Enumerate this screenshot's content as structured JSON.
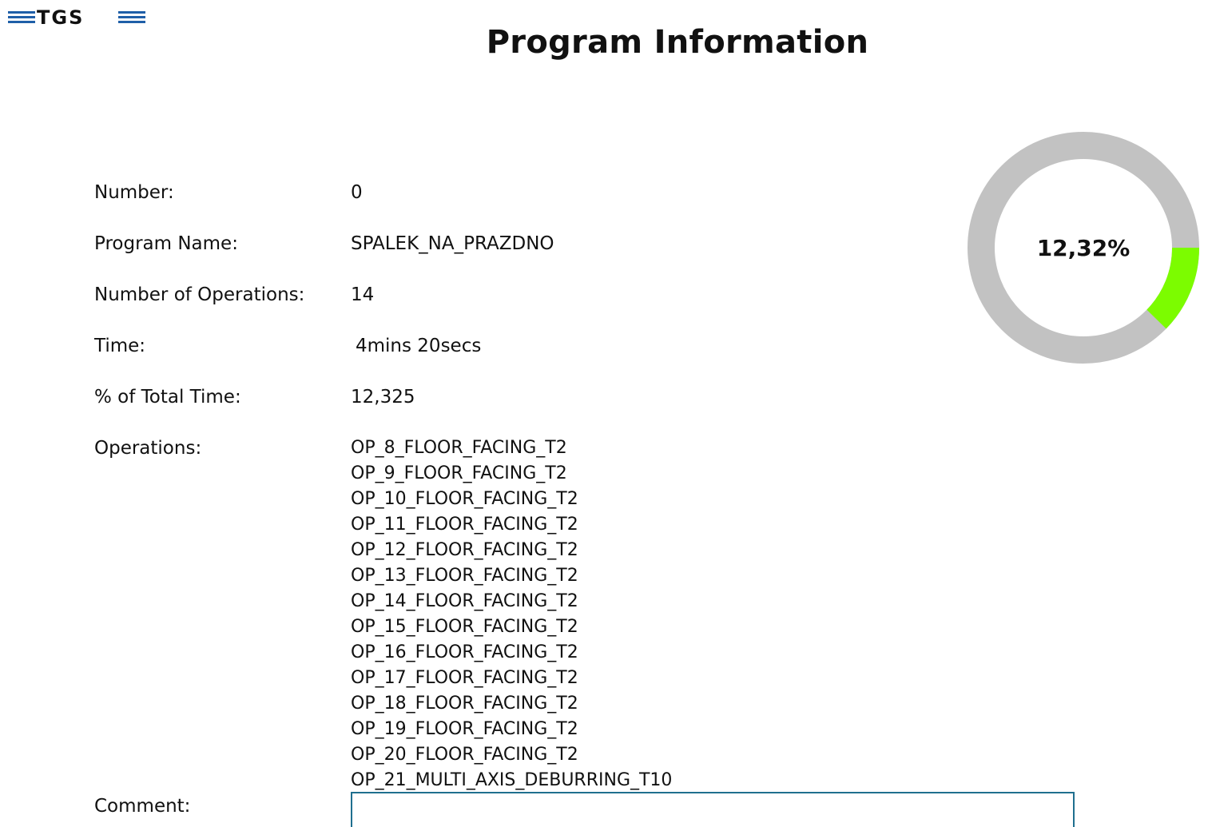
{
  "logo": {
    "text": "TGS",
    "color": "#1f5fa8"
  },
  "page_title": "Program Information",
  "fields": {
    "number": {
      "label": "Number:",
      "value": "0"
    },
    "program_name": {
      "label": "Program Name:",
      "value": "SPALEK_NA_PRAZDNO"
    },
    "num_operations": {
      "label": "Number of Operations:",
      "value": "14"
    },
    "time": {
      "label": "Time:",
      "value": "4mins 20secs"
    },
    "percent_total": {
      "label": "% of Total Time:",
      "value": "12,325"
    },
    "operations": {
      "label": "Operations:",
      "items": [
        "OP_8_FLOOR_FACING_T2",
        "OP_9_FLOOR_FACING_T2",
        "OP_10_FLOOR_FACING_T2",
        "OP_11_FLOOR_FACING_T2",
        "OP_12_FLOOR_FACING_T2",
        "OP_13_FLOOR_FACING_T2",
        "OP_14_FLOOR_FACING_T2",
        "OP_15_FLOOR_FACING_T2",
        "OP_16_FLOOR_FACING_T2",
        "OP_17_FLOOR_FACING_T2",
        "OP_18_FLOOR_FACING_T2",
        "OP_19_FLOOR_FACING_T2",
        "OP_20_FLOOR_FACING_T2",
        "OP_21_MULTI_AXIS_DEBURRING_T10"
      ]
    },
    "comment": {
      "label": "Comment:",
      "value": ""
    }
  },
  "gauge": {
    "label": "12,32%",
    "percent": 12.32,
    "track_color": "#c2c2c2",
    "fill_color": "#7cfc00"
  }
}
